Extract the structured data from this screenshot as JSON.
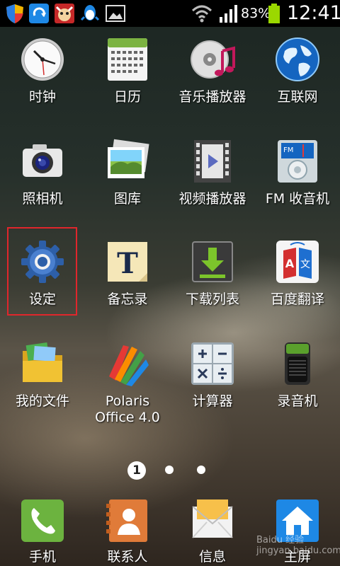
{
  "status_bar": {
    "battery_percent": "83%",
    "time": "12:41",
    "icons": [
      "shield-icon",
      "sync-app-icon",
      "cow-app-icon",
      "qq-icon",
      "gallery-notification-icon",
      "wifi-icon",
      "signal-icon",
      "battery-icon"
    ]
  },
  "apps": [
    {
      "label": "时钟",
      "icon": "clock-icon"
    },
    {
      "label": "日历",
      "icon": "calendar-icon"
    },
    {
      "label": "音乐播放器",
      "icon": "music-player-icon"
    },
    {
      "label": "互联网",
      "icon": "globe-icon"
    },
    {
      "label": "照相机",
      "icon": "camera-icon"
    },
    {
      "label": "图库",
      "icon": "gallery-icon"
    },
    {
      "label": "视频播放器",
      "icon": "video-player-icon"
    },
    {
      "label": "FM 收音机",
      "icon": "fm-radio-icon"
    },
    {
      "label": "设定",
      "icon": "settings-gear-icon"
    },
    {
      "label": "备忘录",
      "icon": "memo-icon"
    },
    {
      "label": "下载列表",
      "icon": "download-icon"
    },
    {
      "label": "百度翻译",
      "icon": "baidu-translate-icon"
    },
    {
      "label": "我的文件",
      "icon": "folder-icon"
    },
    {
      "label": "Polaris Office 4.0",
      "icon": "polaris-office-icon"
    },
    {
      "label": "计算器",
      "icon": "calculator-icon"
    },
    {
      "label": "录音机",
      "icon": "voice-recorder-icon"
    }
  ],
  "pager": {
    "current": "1",
    "total_pages": 3
  },
  "dock": [
    {
      "label": "手机",
      "icon": "phone-icon"
    },
    {
      "label": "联系人",
      "icon": "contacts-icon"
    },
    {
      "label": "信息",
      "icon": "messages-icon"
    },
    {
      "label": "主屏",
      "icon": "home-icon"
    }
  ],
  "watermark": "Baidu 经验 jingyan.baidu.com",
  "colors": {
    "highlight": "#e0262c",
    "status_bar": "#000000",
    "battery": "#9bd800"
  }
}
